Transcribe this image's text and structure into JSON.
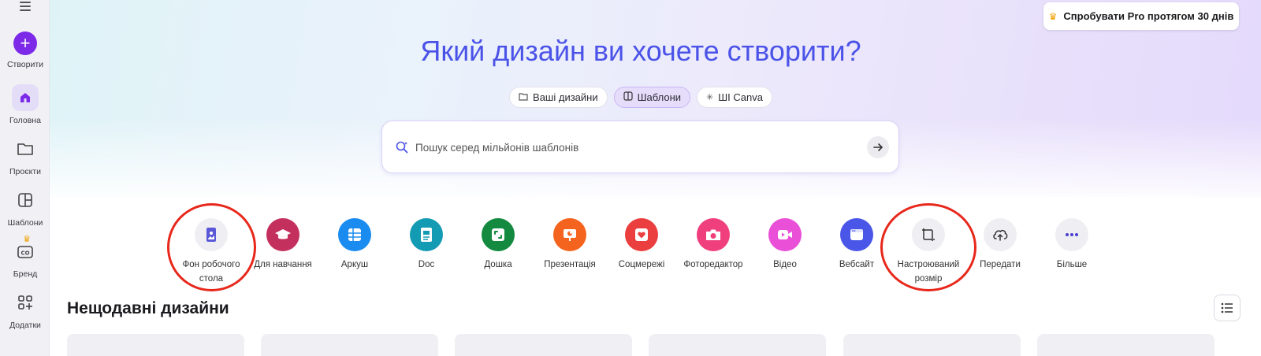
{
  "sidebar": {
    "items": [
      {
        "label": "Створити",
        "icon": "plus-icon"
      },
      {
        "label": "Головна",
        "icon": "home-icon"
      },
      {
        "label": "Проєкти",
        "icon": "folder-icon"
      },
      {
        "label": "Шаблони",
        "icon": "templates-icon"
      },
      {
        "label": "Бренд",
        "icon": "brand-icon"
      },
      {
        "label": "Додатки",
        "icon": "apps-icon"
      }
    ]
  },
  "header": {
    "pro_label": "Спробувати Pro протягом 30 днів",
    "headline": "Який дизайн ви хочете створити?"
  },
  "tabs": [
    {
      "label": "Ваші дизайни",
      "active": false
    },
    {
      "label": "Шаблони",
      "active": true
    },
    {
      "label": "ШІ Canva",
      "active": false
    }
  ],
  "search": {
    "placeholder": "Пошук серед мільйонів шаблонів"
  },
  "categories": [
    {
      "label": "Фон робочого стола",
      "icon": "desktop-wallpaper-icon",
      "color": "#efeff3"
    },
    {
      "label": "Для навчання",
      "icon": "graduation-cap-icon",
      "color": "#c4305e"
    },
    {
      "label": "Аркуш",
      "icon": "sheet-icon",
      "color": "#1a8cf0"
    },
    {
      "label": "Doc",
      "icon": "doc-icon",
      "color": "#139bb4"
    },
    {
      "label": "Дошка",
      "icon": "whiteboard-icon",
      "color": "#138a3f"
    },
    {
      "label": "Презентація",
      "icon": "presentation-icon",
      "color": "#f5641f"
    },
    {
      "label": "Соцмережі",
      "icon": "heart-icon",
      "color": "#eb3e3e"
    },
    {
      "label": "Фоторедактор",
      "icon": "camera-icon",
      "color": "#ef3f7c"
    },
    {
      "label": "Відео",
      "icon": "video-icon",
      "color": "#ea4fd8"
    },
    {
      "label": "Вебсайт",
      "icon": "website-icon",
      "color": "#4a56e8"
    },
    {
      "label": "Настроюваний розмір",
      "icon": "custom-size-icon",
      "color": "#efeff3"
    },
    {
      "label": "Передати",
      "icon": "upload-icon",
      "color": "#efeff3"
    },
    {
      "label": "Більше",
      "icon": "more-icon",
      "color": "#efeff3"
    }
  ],
  "recent": {
    "title": "Нещодавні дизайни"
  },
  "colors": {
    "accent": "#7d2ae8",
    "headline": "#4a52e8",
    "highlight": "#e8271b"
  }
}
